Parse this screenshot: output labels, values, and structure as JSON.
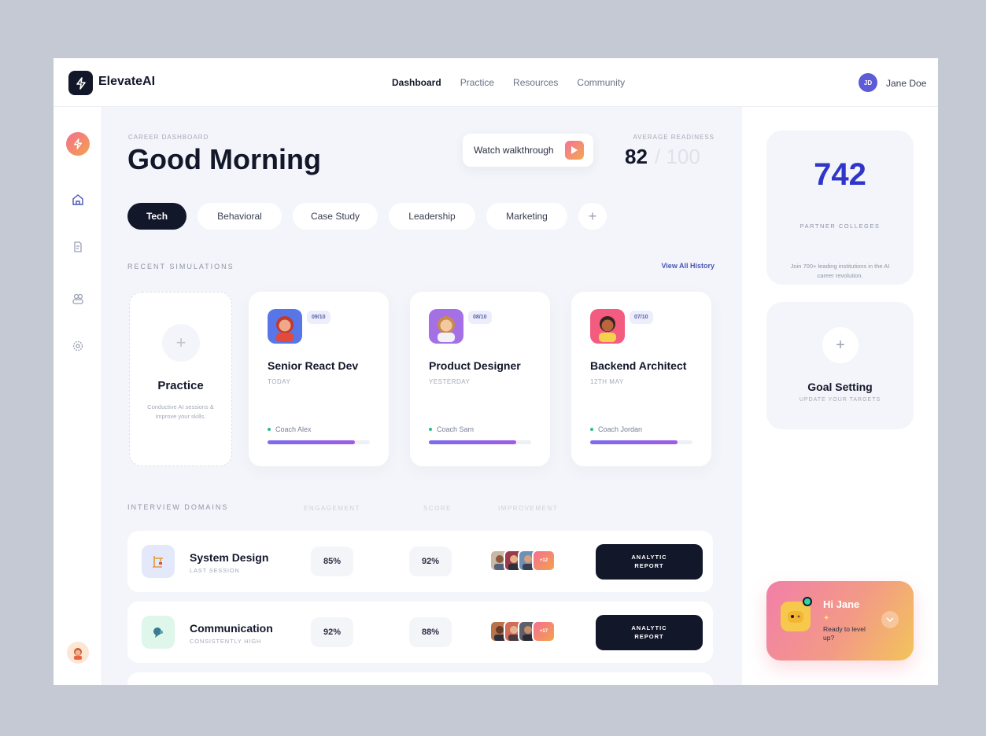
{
  "app": {
    "brand": "ElevateAI"
  },
  "nav": {
    "items": [
      "Dashboard",
      "Practice",
      "Resources",
      "Community"
    ],
    "active": "Dashboard"
  },
  "user": {
    "initials": "JD",
    "name": "Jane Doe"
  },
  "header": {
    "eyebrow": "CAREER DASHBOARD",
    "greeting": "Good Morning",
    "walkthrough_label": "Watch walkthrough",
    "readiness_label": "AVERAGE READINESS",
    "readiness_score": "82",
    "readiness_total": "/ 100"
  },
  "tabs": [
    {
      "label": "Tech",
      "active": true
    },
    {
      "label": "Behavioral",
      "active": false
    },
    {
      "label": "Case Study",
      "active": false
    },
    {
      "label": "Leadership",
      "active": false
    },
    {
      "label": "Marketing",
      "active": false
    }
  ],
  "recent": {
    "heading": "RECENT SIMULATIONS",
    "view_all": "View All History",
    "practice": {
      "title": "Practice",
      "description": "Conductive AI sessions & improve your skills."
    },
    "simulations": [
      {
        "title": "Senior React Dev",
        "date": "TODAY",
        "score": "09/10",
        "coach": "Coach Alex",
        "progress": 0.85,
        "avatar_bg": "#5876e8"
      },
      {
        "title": "Product Designer",
        "date": "YESTERDAY",
        "score": "08/10",
        "coach": "Coach Sam",
        "progress": 0.85,
        "avatar_bg": "#a56fe6"
      },
      {
        "title": "Backend Architect",
        "date": "12TH MAY",
        "score": "07/10",
        "coach": "Coach Jordan",
        "progress": 0.85,
        "avatar_bg": "#f35c7e"
      }
    ]
  },
  "domains": {
    "heading": "INTERVIEW DOMAINS",
    "columns": [
      "ENGAGEMENT",
      "SCORE",
      "IMPROVEMENT"
    ],
    "rows": [
      {
        "name": "System Design",
        "subtitle": "LAST SESSION",
        "engagement": "85%",
        "score": "92%",
        "more": "+12",
        "report_line1": "ANALYTIC",
        "report_line2": "REPORT",
        "icon": "crane-icon",
        "icon_bg": "#e4e8fb"
      },
      {
        "name": "Communication",
        "subtitle": "CONSISTENTLY HIGH",
        "engagement": "92%",
        "score": "88%",
        "more": "+17",
        "report_line1": "ANALYTIC",
        "report_line2": "REPORT",
        "icon": "speech-icon",
        "icon_bg": "#dff6ea"
      }
    ]
  },
  "stats": {
    "number": "742",
    "label": "PARTNER COLLEGES",
    "description": "Join 700+ leading institutions in the AI career revolution."
  },
  "goal": {
    "title": "Goal Setting",
    "subtitle": "UPDATE YOUR TARGETS"
  },
  "chat": {
    "greeting": "Hi Jane",
    "sparkle": "✦",
    "message": "Ready to level up?"
  },
  "colors": {
    "accent": "#2f36c9",
    "dark": "#13172a",
    "gradient_start": "#f36f91",
    "gradient_end": "#f3a24d"
  }
}
